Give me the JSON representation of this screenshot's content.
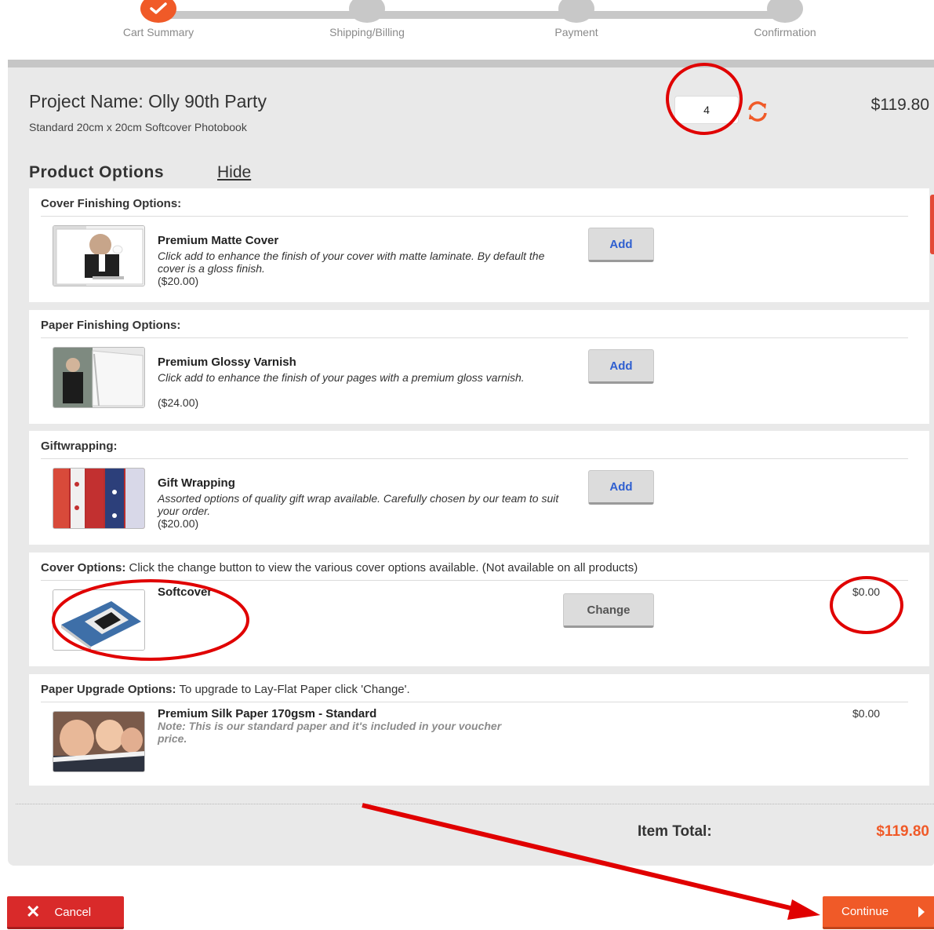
{
  "steps": [
    {
      "label": "Cart Summary",
      "state": "done"
    },
    {
      "label": "Shipping/Billing",
      "state": "pending"
    },
    {
      "label": "Payment",
      "state": "pending"
    },
    {
      "label": "Confirmation",
      "state": "pending"
    }
  ],
  "project": {
    "title": "Project Name: Olly 90th Party",
    "subtitle": "Standard 20cm x 20cm Softcover Photobook",
    "quantity": "4",
    "price": "$119.80"
  },
  "product_options": {
    "heading": "Product Options",
    "hide_label": "Hide"
  },
  "cards": {
    "cover_finishing": {
      "title": "Cover Finishing Options:",
      "name": "Premium Matte Cover",
      "desc": "Click add to enhance the finish of your cover with matte laminate. By default the cover is a gloss finish.",
      "price": "($20.00)",
      "button": "Add"
    },
    "paper_finishing": {
      "title": "Paper Finishing Options:",
      "name": "Premium Glossy Varnish",
      "desc": "Click add to enhance the finish of your pages with a premium gloss varnish.",
      "price": "($24.00)",
      "button": "Add"
    },
    "giftwrapping": {
      "title": "Giftwrapping:",
      "name": "Gift Wrapping",
      "desc": "Assorted options of quality gift wrap available. Carefully chosen by our team to suit your order.",
      "price": "($20.00)",
      "button": "Add"
    },
    "cover_options": {
      "title": "Cover Options:",
      "title_note": "Click the change button to view the various cover options available. (Not available on all products)",
      "name": "Softcover",
      "button": "Change",
      "price": "$0.00"
    },
    "paper_upgrade": {
      "title": "Paper Upgrade Options:",
      "title_note": "To upgrade to Lay-Flat Paper click 'Change'.",
      "name": "Premium Silk Paper 170gsm - Standard",
      "desc": "Note: This is our standard paper and it's included in your voucher price.",
      "price": "$0.00"
    }
  },
  "item_total": {
    "label": "Item Total:",
    "value": "$119.80"
  },
  "actions": {
    "cancel": "Cancel",
    "continue": "Continue"
  },
  "colors": {
    "accent": "#f05a28",
    "cancel": "#d92a2a",
    "add_text": "#2f5fd0",
    "annotation": "#e00000",
    "panel_bg": "#e9e9e9"
  },
  "icons": {
    "step_done": "check-icon",
    "refresh": "refresh-icon",
    "cancel": "x-icon",
    "continue": "caret-right-icon"
  }
}
